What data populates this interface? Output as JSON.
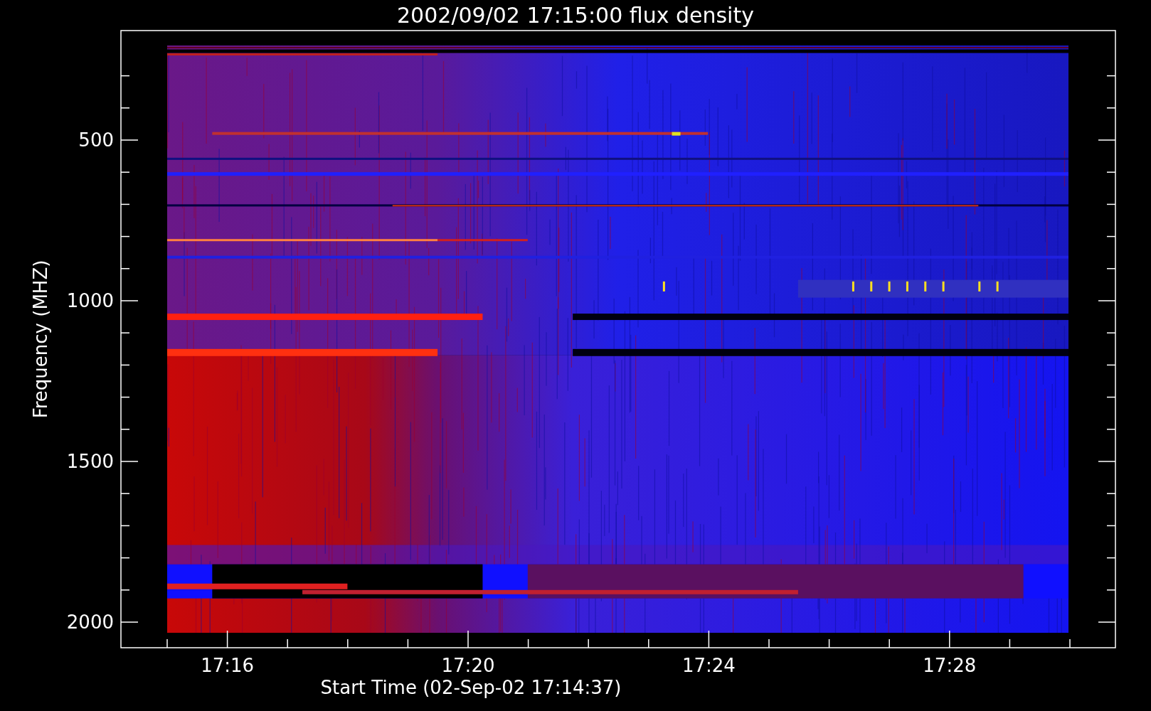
{
  "title": "2002/09/02 17:15:00 flux density",
  "y_axis": {
    "label": "Frequency (MHZ)",
    "ticks": [
      "500",
      "1000",
      "1500",
      "2000"
    ]
  },
  "x_axis": {
    "label": "Start Time (02-Sep-02 17:14:37)",
    "ticks": [
      "17:16",
      "17:20",
      "17:24",
      "17:28"
    ]
  }
}
